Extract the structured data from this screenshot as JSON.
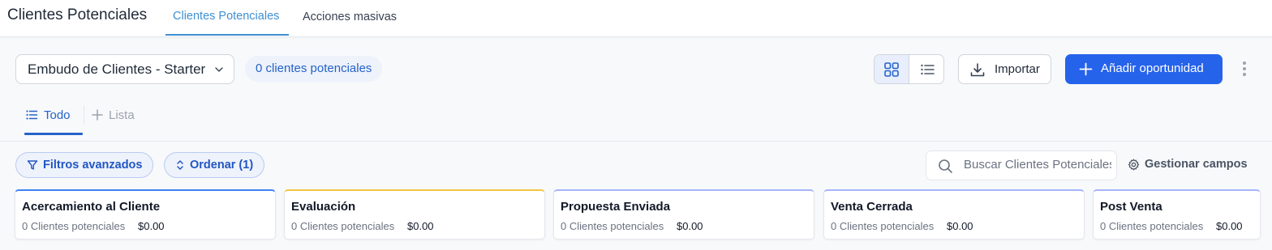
{
  "header": {
    "title": "Clientes Potenciales",
    "tabs": [
      {
        "label": "Clientes Potenciales",
        "active": true
      },
      {
        "label": "Acciones masivas",
        "active": false
      }
    ]
  },
  "toolbar": {
    "pipeline_select": "Embudo de Clientes - Starter",
    "count_badge": "0 clientes potenciales",
    "view_modes": [
      "grid-icon",
      "list-icon"
    ],
    "active_view": "grid",
    "import_label": "Importar",
    "add_label": "Añadir oportunidad"
  },
  "views": {
    "tabs": [
      {
        "label": "Todo",
        "icon": "list-icon",
        "active": true
      }
    ],
    "add_label": "Lista"
  },
  "filters": {
    "advanced_label": "Filtros avanzados",
    "sort_label": "Ordenar (1)",
    "search_placeholder": "Buscar Clientes Potenciales",
    "manage_fields_label": "Gestionar campos"
  },
  "stages": [
    {
      "name": "Acercamiento al Cliente",
      "count": "0 Clientes potenciales",
      "amount": "$0.00",
      "color": "#3b82f6"
    },
    {
      "name": "Evaluación",
      "count": "0 Clientes potenciales",
      "amount": "$0.00",
      "color": "#f5c542"
    },
    {
      "name": "Propuesta Enviada",
      "count": "0 Clientes potenciales",
      "amount": "$0.00",
      "color": "#a5b4fc"
    },
    {
      "name": "Venta Cerrada",
      "count": "0 Clientes potenciales",
      "amount": "$0.00",
      "color": "#a5b4fc"
    },
    {
      "name": "Post Venta",
      "count": "0 Clientes potenciales",
      "amount": "$0.00",
      "color": "#a5b4fc"
    }
  ],
  "colors": {
    "accent": "#2563eb",
    "tab_active": "#3f8fd2"
  }
}
